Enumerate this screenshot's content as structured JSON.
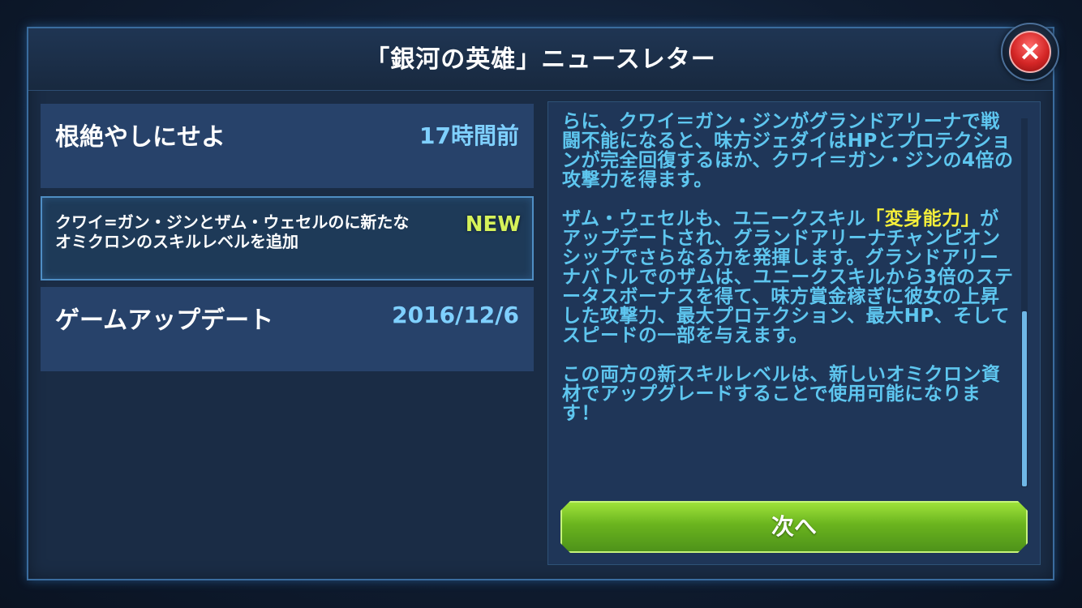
{
  "dialog": {
    "title": "「銀河の英雄」ニュースレター",
    "close_label": "×"
  },
  "list": {
    "items": [
      {
        "title": "根絶やしにせよ",
        "meta": "17時間前"
      },
      {
        "title": "クワイ=ガン・ジンとザム・ウェセルのに新たなオミクロンのスキルレベルを追加",
        "badge": "NEW"
      },
      {
        "title": "ゲームアップデート",
        "meta": "2016/12/6"
      }
    ]
  },
  "detail": {
    "para1": "らに、クワイ＝ガン・ジンがグランドアリーナで戦闘不能になると、味方ジェダイはHPとプロテクションが完全回復するほか、クワイ＝ガン・ジンの4倍の攻撃力を得ます。",
    "para2_pre": "ザム・ウェセルも、ユニークスキル",
    "para2_highlight": "「変身能力」",
    "para2_post": "がアップデートされ、グランドアリーナチャンピオンシップでさらなる力を発揮します。グランドアリーナバトルでのザムは、ユニークスキルから3倍のステータスボーナスを得て、味方賞金稼ぎに彼女の上昇した攻撃力、最大プロテクション、最大HP、そしてスピードの一部を与えます。",
    "para3": "この両方の新スキルレベルは、新しいオミクロン資材でアップグレードすることで使用可能になります！",
    "next_label": "次へ"
  },
  "colors": {
    "accent_blue": "#5ec6ef",
    "highlight_yellow": "#f5ef3a",
    "new_badge": "#d6f25a",
    "button_green": "#6ab41e",
    "close_red": "#d42626"
  }
}
